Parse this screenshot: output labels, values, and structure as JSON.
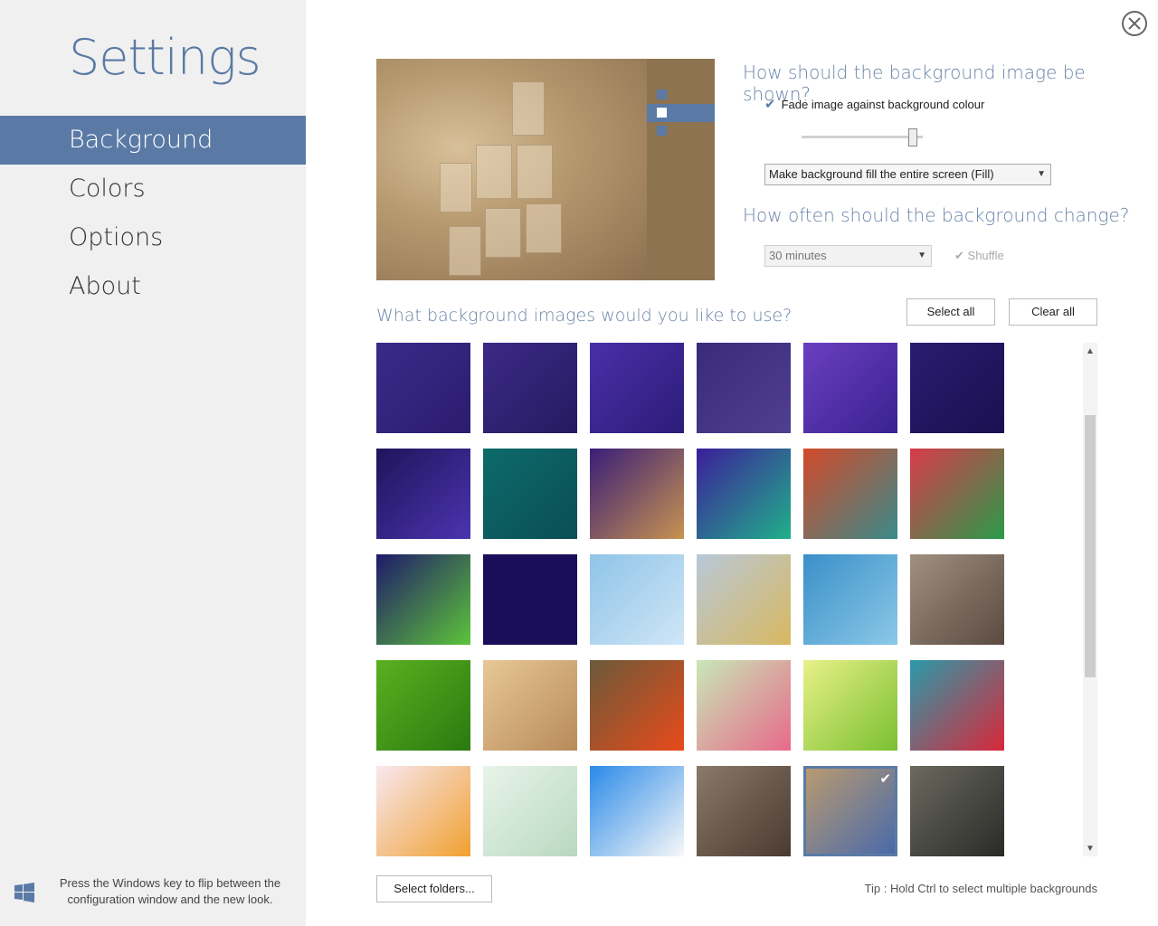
{
  "app": {
    "title": "Settings"
  },
  "sidebar": {
    "items": [
      {
        "label": "Background",
        "active": true
      },
      {
        "label": "Colors",
        "active": false
      },
      {
        "label": "Options",
        "active": false
      },
      {
        "label": "About",
        "active": false
      }
    ],
    "hint": "Press the Windows key to flip between the configuration window and the new look."
  },
  "display": {
    "question": "How should the background image be shown?",
    "fade_label": "Fade image against background colour",
    "fade_checked": true,
    "fade_level": 0.95,
    "fill_mode": "Make background fill the entire screen (Fill)"
  },
  "frequency": {
    "question": "How often should the background change?",
    "interval": "30 minutes",
    "shuffle_label": "Shuffle",
    "shuffle_checked": true
  },
  "images": {
    "question": "What background images would you like to use?",
    "select_all": "Select all",
    "clear_all": "Clear all",
    "select_folders": "Select folders...",
    "tip": "Tip : Hold Ctrl to select multiple backgrounds",
    "thumbnails": [
      {
        "name": "purple-chameleon",
        "colors": [
          "#3a2a8a",
          "#2b1c6e"
        ],
        "selected": false
      },
      {
        "name": "purple-camera",
        "colors": [
          "#3b2a86",
          "#251a60"
        ],
        "selected": false
      },
      {
        "name": "purple-prism",
        "colors": [
          "#4a2fa8",
          "#2c1c78"
        ],
        "selected": false
      },
      {
        "name": "purple-gears",
        "colors": [
          "#3a2a7a",
          "#4f3f8e"
        ],
        "selected": false
      },
      {
        "name": "purple-guitar",
        "colors": [
          "#6a3fc0",
          "#3a2290"
        ],
        "selected": false
      },
      {
        "name": "purple-drop",
        "colors": [
          "#2a1c70",
          "#1a1050"
        ],
        "selected": false
      },
      {
        "name": "night-sky",
        "colors": [
          "#20145a",
          "#4a34b0"
        ],
        "selected": false
      },
      {
        "name": "teal-circles",
        "colors": [
          "#0d6a6a",
          "#0a4e55"
        ],
        "selected": false
      },
      {
        "name": "purple-giraffe",
        "colors": [
          "#3a1e78",
          "#c79250"
        ],
        "selected": false
      },
      {
        "name": "purple-wave",
        "colors": [
          "#3c1e9a",
          "#20b08a"
        ],
        "selected": false
      },
      {
        "name": "orange-pattern",
        "colors": [
          "#d24a2a",
          "#3a8a8a"
        ],
        "selected": false
      },
      {
        "name": "red-flower",
        "colors": [
          "#d83a4a",
          "#2a9a4a"
        ],
        "selected": false
      },
      {
        "name": "rainbow-landscape",
        "colors": [
          "#1f1a6a",
          "#5cc43a"
        ],
        "selected": false
      },
      {
        "name": "dark-purple",
        "colors": [
          "#1a0e5a",
          "#1a0e5a"
        ],
        "selected": false
      },
      {
        "name": "ice",
        "colors": [
          "#8fc4e8",
          "#cfe6f6"
        ],
        "selected": false
      },
      {
        "name": "hills",
        "colors": [
          "#b8c8d8",
          "#d8b860"
        ],
        "selected": false
      },
      {
        "name": "coast",
        "colors": [
          "#3a90c8",
          "#8cc8e8"
        ],
        "selected": false
      },
      {
        "name": "rock-shore",
        "colors": [
          "#a09080",
          "#5a4a40"
        ],
        "selected": false
      },
      {
        "name": "green-field",
        "colors": [
          "#5ab020",
          "#2a7a10"
        ],
        "selected": false
      },
      {
        "name": "desert-dune",
        "colors": [
          "#e8c896",
          "#b88a5a"
        ],
        "selected": false
      },
      {
        "name": "red-tulip",
        "colors": [
          "#6a5a3a",
          "#e84a1a"
        ],
        "selected": false
      },
      {
        "name": "pink-flower",
        "colors": [
          "#c8e8b8",
          "#e86a8a"
        ],
        "selected": false
      },
      {
        "name": "green-leaf",
        "colors": [
          "#e8f088",
          "#7ac030"
        ],
        "selected": false
      },
      {
        "name": "red-bloom",
        "colors": [
          "#2a9aaa",
          "#d8283a"
        ],
        "selected": false
      },
      {
        "name": "orange-petals",
        "colors": [
          "#f8e8f0",
          "#f0a030"
        ],
        "selected": false
      },
      {
        "name": "pale-green",
        "colors": [
          "#e8f4ea",
          "#b8d8c0"
        ],
        "selected": false
      },
      {
        "name": "daisy",
        "colors": [
          "#2a8ae8",
          "#f8f8f8"
        ],
        "selected": false
      },
      {
        "name": "cracked-earth",
        "colors": [
          "#8a7a6a",
          "#4a3a30"
        ],
        "selected": false
      },
      {
        "name": "mosaic-vase",
        "colors": [
          "#b89a70",
          "#4a6aaa"
        ],
        "selected": true
      },
      {
        "name": "stone-urn",
        "colors": [
          "#6a6a60",
          "#2a2a28"
        ],
        "selected": false
      }
    ]
  },
  "colors": {
    "accent": "#5a7aa5",
    "sidebar_bg": "#f0f0f0"
  }
}
